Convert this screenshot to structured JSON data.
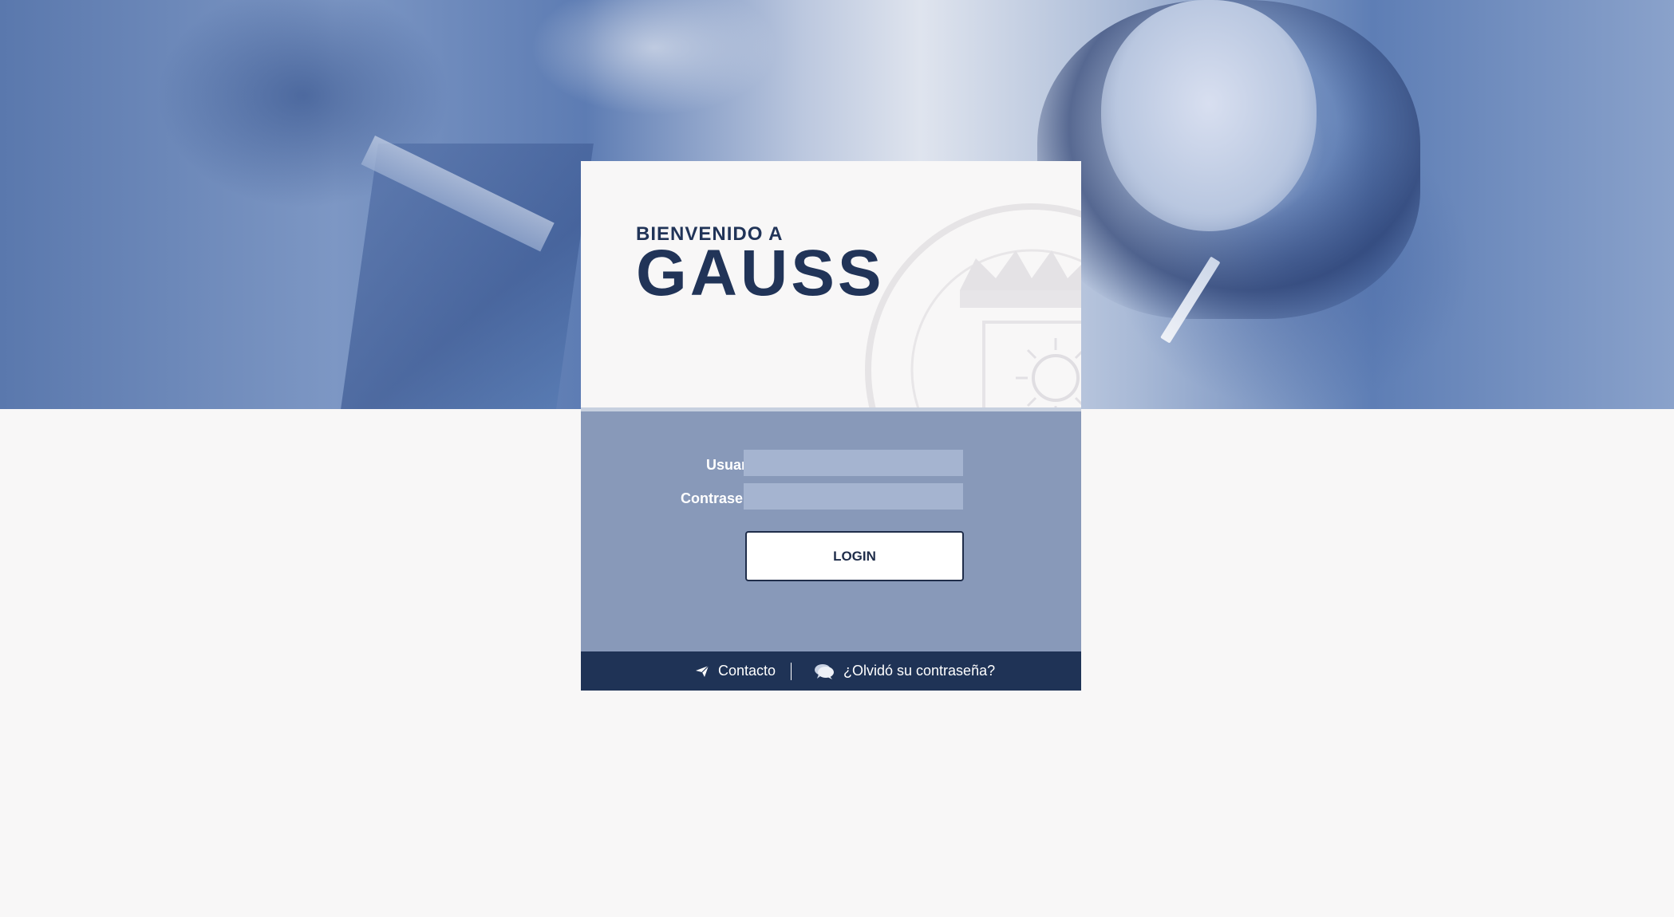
{
  "welcome": {
    "subtitle": "BIENVENIDO A",
    "title": "GAUSS"
  },
  "form": {
    "username_label": "Usuario",
    "username_value": "",
    "password_label": "Contraseña",
    "password_value": "",
    "login_button": "LOGIN"
  },
  "footer": {
    "contact_label": "Contacto",
    "contact_icon": "paper-plane-icon",
    "forgot_label": "¿Olvidó su contraseña?",
    "forgot_icon": "chat-bubbles-icon"
  },
  "colors": {
    "brand_dark": "#1f3356",
    "panel": "#8899b9",
    "input_bg": "#a5b4d0",
    "page_bg": "#f8f7f7"
  }
}
